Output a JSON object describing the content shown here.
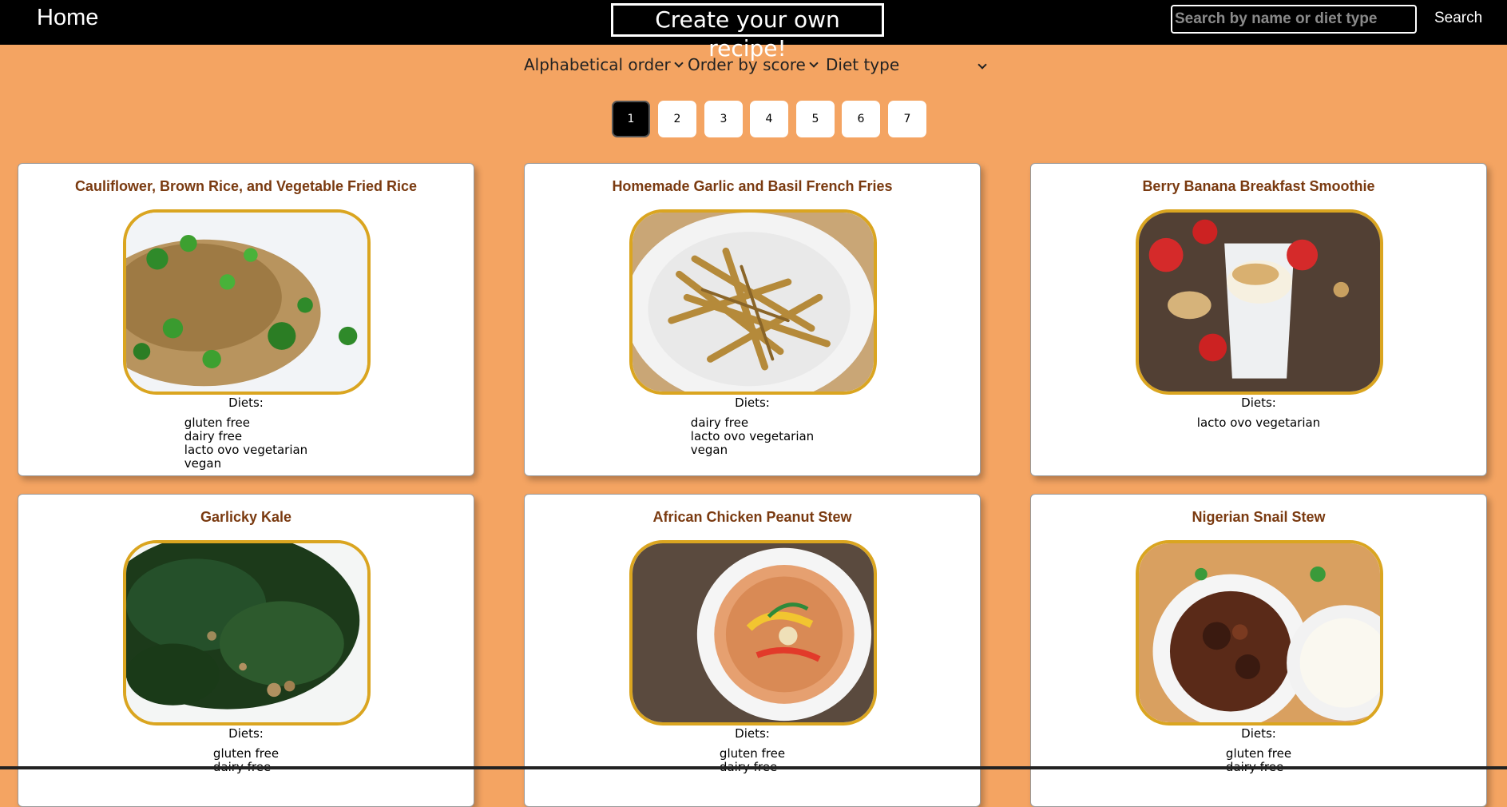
{
  "navbar": {
    "home_label": "Home",
    "create_label": "Create your own recipe!",
    "search_placeholder": "Search by name or diet type",
    "search_label": "Search"
  },
  "filters": {
    "alphabetical": "Alphabetical order",
    "score": "Order by score",
    "diet": "Diet type"
  },
  "pagination": [
    "1",
    "2",
    "3",
    "4",
    "5",
    "6",
    "7"
  ],
  "current_page": "1",
  "diets_label": "Diets:",
  "recipes": [
    {
      "title": "Cauliflower, Brown Rice, and Vegetable Fried Rice",
      "diets": [
        "gluten free",
        "dairy free",
        "lacto ovo vegetarian",
        "vegan"
      ]
    },
    {
      "title": "Homemade Garlic and Basil French Fries",
      "diets": [
        "dairy free",
        "lacto ovo vegetarian",
        "vegan"
      ]
    },
    {
      "title": "Berry Banana Breakfast Smoothie",
      "diets": [
        "lacto ovo vegetarian"
      ]
    },
    {
      "title": "Garlicky Kale",
      "diets": [
        "gluten free",
        "dairy free"
      ]
    },
    {
      "title": "African Chicken Peanut Stew",
      "diets": [
        "gluten free",
        "dairy free"
      ]
    },
    {
      "title": "Nigerian Snail Stew",
      "diets": [
        "gluten free",
        "dairy free"
      ]
    }
  ],
  "colors": {
    "background": "#f4a462",
    "navbar": "#000000",
    "title": "#7a3a10",
    "image_border": "#daa520"
  }
}
